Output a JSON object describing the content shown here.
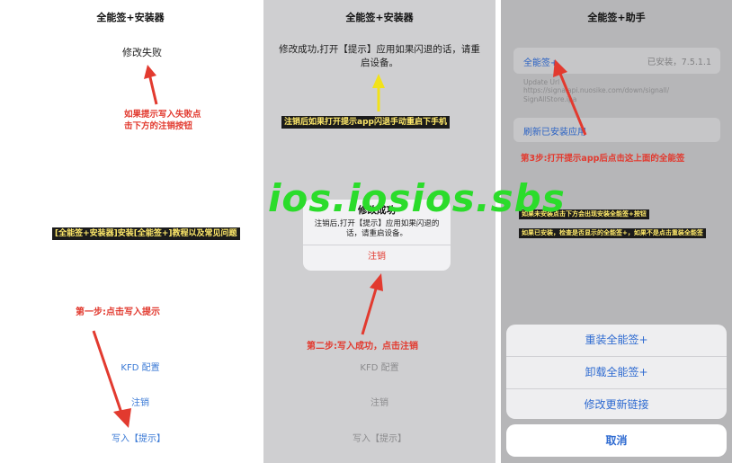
{
  "panel1": {
    "title": "全能签+安装器",
    "status": "修改失败",
    "hint": "如果提示写入失败点\n击下方的注销按钮",
    "guide_banner": "[全能签+安装器]安装[全能签+]教程以及常见问题",
    "step1": "第一步:点击写入提示",
    "buttons": {
      "kfd": "KFD 配置",
      "logout": "注销",
      "write": "写入【提示】"
    }
  },
  "panel2": {
    "title": "全能签+安装器",
    "status": "修改成功,打开【提示】应用如果闪退的话，请重启设备。",
    "restart_hint": "注销后如果打开提示app闪退手动重启下手机",
    "alert": {
      "title": "修改成功",
      "message": "注销后,打开【提示】应用如果闪退的话，请重启设备。",
      "button": "注销"
    },
    "step2": "第二步:写入成功，点击注销",
    "buttons": {
      "kfd": "KFD 配置",
      "logout": "注销",
      "write": "写入【提示】"
    }
  },
  "panel3": {
    "title": "全能签+助手",
    "app_name": "全能签+",
    "app_status": "已安装，7.5.1.1",
    "update_label": "Update Url",
    "update_url": "https://signalapi.nuosike.com/down/signall/\nSignAllStore.ipa",
    "refresh": "刷新已安装应用",
    "step3": "第3步:打开提示app后点击这上面的全能签",
    "note1": "如果未安装点击下方会出现安装全能签+按钮",
    "note2": "如果已安装，检查是否显示的全能签+，如果不是点击重装全能签",
    "sheet": {
      "reinstall": "重装全能签+",
      "uninstall": "卸载全能签+",
      "modify_link": "修改更新链接",
      "cancel": "取消"
    }
  },
  "watermark": "ios.iosios.sbs",
  "colors": {
    "annotation_red": "#e23a2f",
    "link_blue": "#3b7ad6",
    "watermark_green": "#2bdc2b",
    "banner_yellow": "#ffe96a"
  }
}
